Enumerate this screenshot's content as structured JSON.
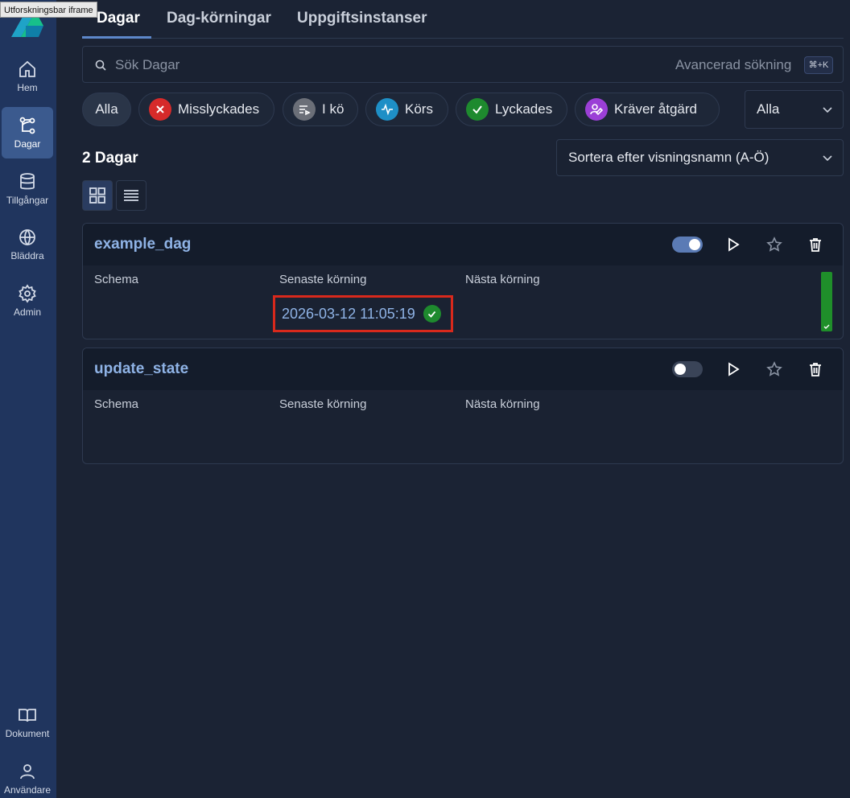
{
  "iframe_label": "Utforskningsbar iframe",
  "sidebar": {
    "items": [
      {
        "label": "Hem",
        "icon": "home-icon"
      },
      {
        "label": "Dagar",
        "icon": "dag-icon",
        "active": true
      },
      {
        "label": "Tillgångar",
        "icon": "database-icon"
      },
      {
        "label": "Bläddra",
        "icon": "globe-icon"
      },
      {
        "label": "Admin",
        "icon": "gear-icon"
      }
    ],
    "bottom_items": [
      {
        "label": "Dokument",
        "icon": "book-icon"
      },
      {
        "label": "Användare",
        "icon": "user-icon"
      }
    ]
  },
  "tabs": [
    {
      "label": "Dagar",
      "active": true
    },
    {
      "label": "Dag-körningar"
    },
    {
      "label": "Uppgiftsinstanser"
    }
  ],
  "search": {
    "placeholder": "Sök Dagar",
    "value": "",
    "advanced_label": "Avancerad sökning",
    "shortcut": "⌘+K"
  },
  "filters": {
    "chips": [
      {
        "label": "Alla",
        "active": true
      },
      {
        "label": "Misslyckades",
        "color": "#d62a2a",
        "icon": "x-icon"
      },
      {
        "label": "I kö",
        "color": "#6b6f78",
        "icon": "queue-icon"
      },
      {
        "label": "Körs",
        "color": "#1e8fc6",
        "icon": "activity-icon"
      },
      {
        "label": "Lyckades",
        "color": "#1e8a2e",
        "icon": "check-icon"
      },
      {
        "label": "Kräver åtgärd",
        "color": "#9b3fd6",
        "icon": "user-action-icon"
      }
    ],
    "select_value": "Alla"
  },
  "list": {
    "count_label": "2 Dagar",
    "sort_value": "Sortera efter visningsnamn (A-Ö)"
  },
  "columns": {
    "schedule": "Schema",
    "last_run": "Senaste körning",
    "next_run": "Nästa körning"
  },
  "dags": [
    {
      "name": "example_dag",
      "enabled": true,
      "last_run": "2026-03-12 11:05:19",
      "last_run_state": "success"
    },
    {
      "name": "update_state",
      "enabled": false,
      "last_run": "",
      "last_run_state": ""
    }
  ]
}
